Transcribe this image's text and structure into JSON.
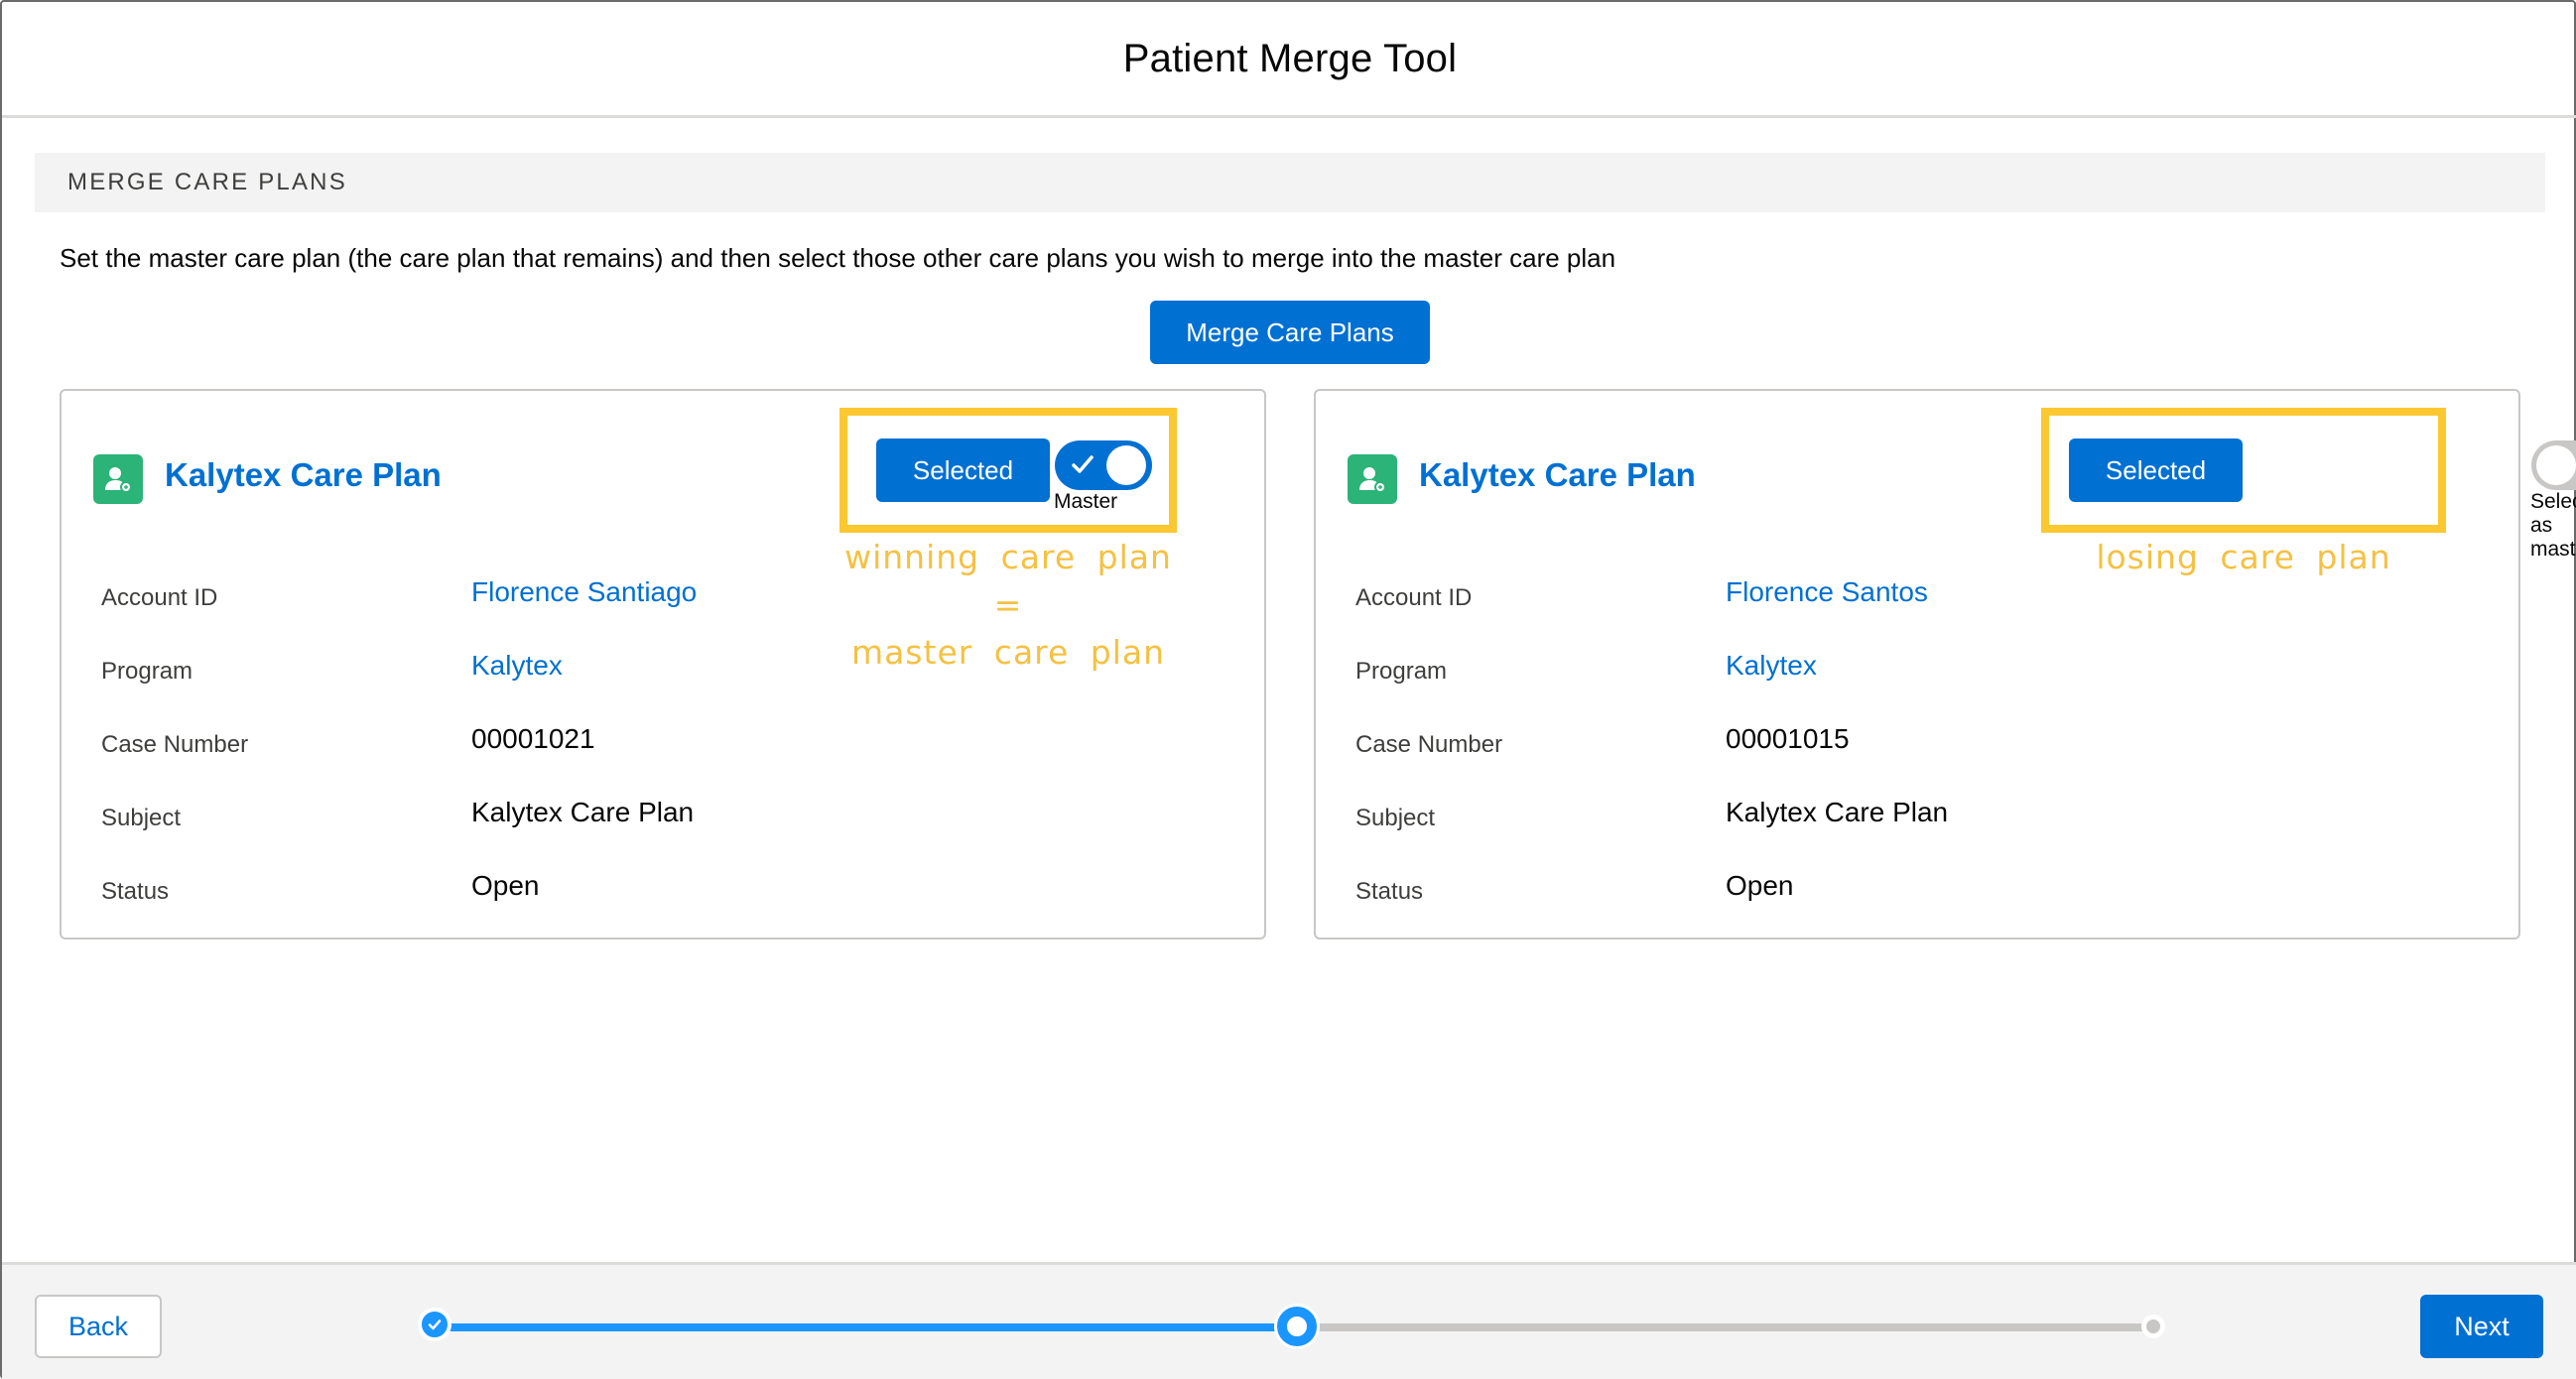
{
  "header": {
    "title": "Patient Merge Tool"
  },
  "section": {
    "title": "MERGE CARE PLANS"
  },
  "instructions": "Set the master care plan (the care plan that remains) and then select those other care plans you wish to merge into the master care plan",
  "merge_button": "Merge Care Plans",
  "field_labels": {
    "account_id": "Account ID",
    "program": "Program",
    "case_number": "Case Number",
    "subject": "Subject",
    "status": "Status"
  },
  "cards": [
    {
      "title": "Kalytex Care Plan",
      "selected_label": "Selected",
      "toggle_on": true,
      "toggle_label": "Master",
      "account_id": "Florence Santiago",
      "program": "Kalytex",
      "case_number": "00001021",
      "subject": "Kalytex Care Plan",
      "status": "Open",
      "annotation_line1": "winning care plan =",
      "annotation_line2": "master care plan"
    },
    {
      "title": "Kalytex Care Plan",
      "selected_label": "Selected",
      "toggle_on": false,
      "toggle_label": "Select as master",
      "account_id": "Florence Santos",
      "program": "Kalytex",
      "case_number": "00001015",
      "subject": "Kalytex Care Plan",
      "status": "Open",
      "annotation_line1": "losing care plan"
    }
  ],
  "footer": {
    "back_label": "Back",
    "next_label": "Next",
    "progress": {
      "current_step": 2,
      "total_steps": 3,
      "completed_fraction": 0.5
    }
  },
  "colors": {
    "brand": "#0070d2",
    "progress": "#1b96ff",
    "highlight": "#fbc831",
    "care_plan_icon": "#2bb378"
  },
  "icons": [
    "care-plan-icon",
    "checkmark-icon",
    "step-complete-icon"
  ]
}
